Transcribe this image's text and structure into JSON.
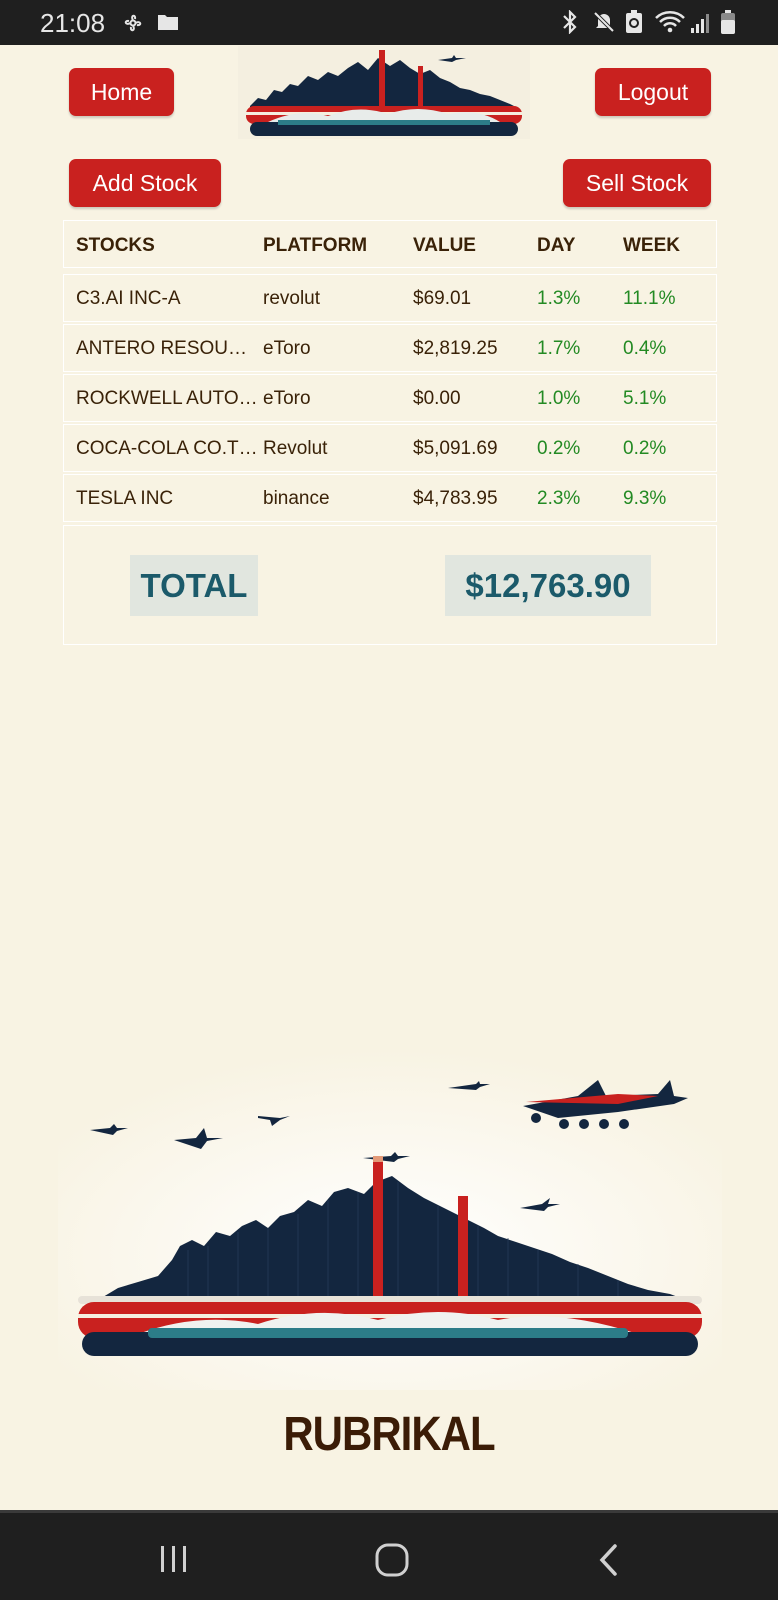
{
  "status_bar": {
    "time": "21:08",
    "left_icons": [
      "fan-icon",
      "folder-icon"
    ],
    "right_icons": [
      "bluetooth-icon",
      "mute-icon",
      "battery-saver-icon",
      "wifi-icon",
      "signal-icon",
      "battery-icon"
    ]
  },
  "header": {
    "home_label": "Home",
    "logout_label": "Logout"
  },
  "actions": {
    "add_label": "Add Stock",
    "sell_label": "Sell Stock"
  },
  "table": {
    "headers": [
      "STOCKS",
      "PLATFORM",
      "VALUE",
      "DAY",
      "WEEK"
    ],
    "rows": [
      {
        "stock": "C3.AI INC-A",
        "platform": "revolut",
        "value": "$69.01",
        "day": "1.3%",
        "week": "11.1%"
      },
      {
        "stock": "ANTERO RESOURCES",
        "platform": "eToro",
        "value": "$2,819.25",
        "day": "1.7%",
        "week": "0.4%"
      },
      {
        "stock": "ROCKWELL AUTOMATION",
        "platform": "eToro",
        "value": "$0.00",
        "day": "1.0%",
        "week": "5.1%"
      },
      {
        "stock": "COCA-COLA CO.THE",
        "platform": "Revolut",
        "value": "$5,091.69",
        "day": "0.2%",
        "week": "0.2%"
      },
      {
        "stock": "TESLA INC",
        "platform": "binance",
        "value": "$4,783.95",
        "day": "2.3%",
        "week": "9.3%"
      }
    ],
    "total_label": "TOTAL",
    "total_value": "$12,763.90"
  },
  "brand_name": "RUBRIKAL",
  "colors": {
    "background": "#f8f3e3",
    "button": "#c9211f",
    "positive": "#238a23",
    "total_text": "#1b5a6a",
    "navy": "#13263f"
  },
  "nav_bar": {
    "icons": [
      "recents-icon",
      "home-circle-icon",
      "back-icon"
    ]
  }
}
